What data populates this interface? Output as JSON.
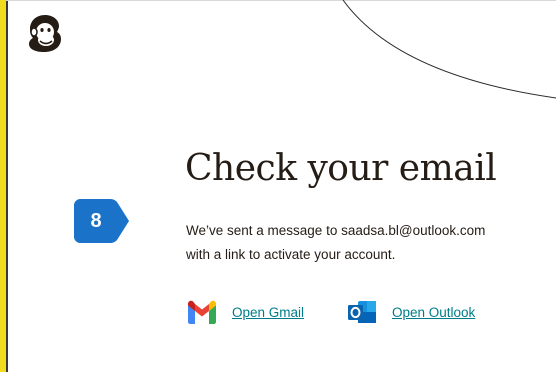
{
  "brand": {
    "logo_icon": "mailchimp-freddie-icon",
    "accent_stripe_color": "#f2dc1e",
    "link_color": "#007c89"
  },
  "step": {
    "number": "8",
    "color": "#1a73c8"
  },
  "main": {
    "title": "Check your email",
    "message_line1": "We’ve sent a message to saadsa.bl@outlook.com",
    "message_line2": "with a  link to activate your account."
  },
  "links": {
    "gmail": {
      "label": "Open Gmail",
      "icon": "gmail-icon"
    },
    "outlook": {
      "label": "Open Outlook",
      "icon": "outlook-icon"
    }
  }
}
